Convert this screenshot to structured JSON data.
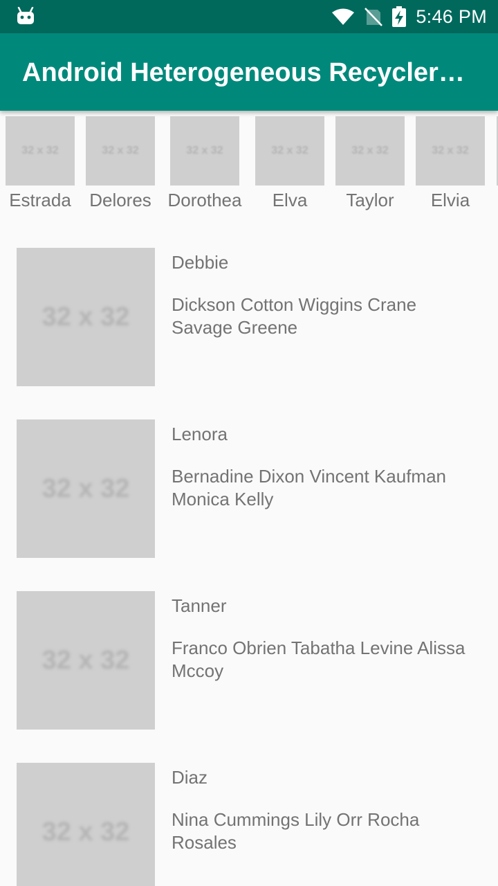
{
  "status_bar": {
    "time": "5:46 PM",
    "icons": [
      "android-icon",
      "wifi-icon",
      "no-signal-icon",
      "battery-charging-icon"
    ]
  },
  "app_bar": {
    "title": "Android Heterogeneous RecyclerView"
  },
  "colors": {
    "status_bar": "#00695c",
    "app_bar": "#00897b",
    "background": "#fafafa",
    "placeholder": "#cfcfcf",
    "text": "#737373"
  },
  "placeholder_text": "32 x 32",
  "horizontal_items": [
    {
      "label": "Estrada"
    },
    {
      "label": "Delores"
    },
    {
      "label": "Dorothea"
    },
    {
      "label": "Elva"
    },
    {
      "label": "Taylor"
    },
    {
      "label": "Elvia"
    }
  ],
  "list_items": [
    {
      "title": "Debbie",
      "description": "Dickson Cotton Wiggins Crane Savage Greene"
    },
    {
      "title": "Lenora",
      "description": "Bernadine Dixon Vincent Kaufman Monica Kelly"
    },
    {
      "title": "Tanner",
      "description": "Franco Obrien Tabatha Levine Alissa Mccoy"
    },
    {
      "title": "Diaz",
      "description": "Nina Cummings Lily Orr Rocha Rosales"
    }
  ]
}
